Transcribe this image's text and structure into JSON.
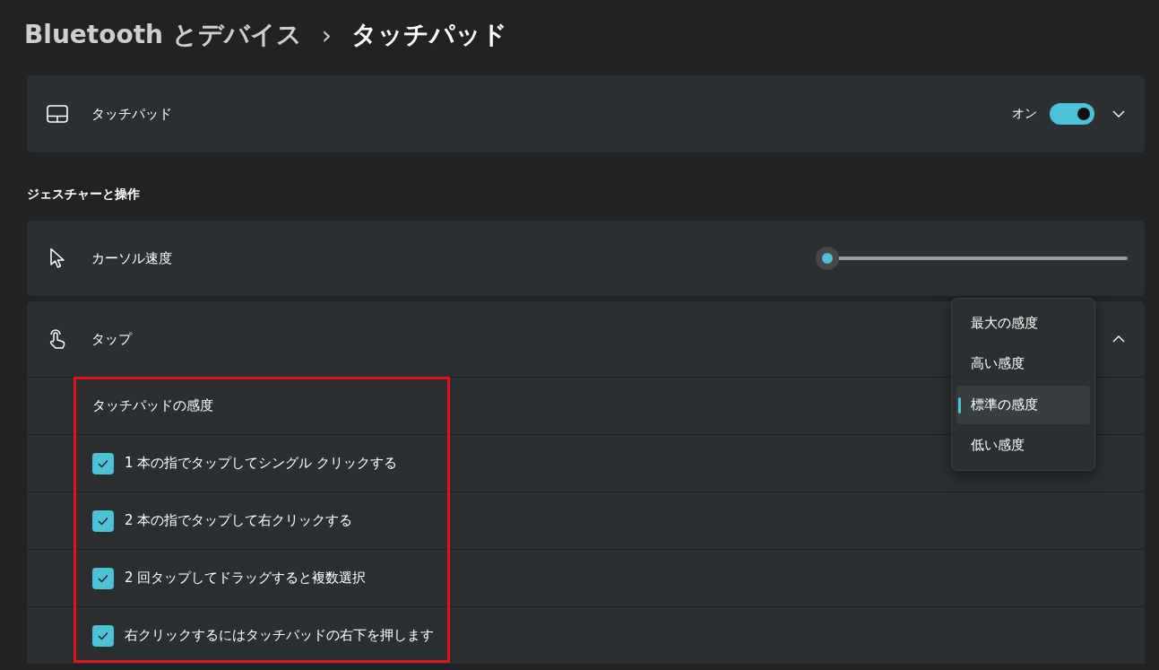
{
  "breadcrumb": {
    "parent": "Bluetooth とデバイス",
    "separator": "›",
    "current": "タッチパッド"
  },
  "touchpad": {
    "label": "タッチパッド",
    "state_label": "オン",
    "on": true,
    "expanded": false
  },
  "section_title": "ジェスチャーと操作",
  "cursor_speed": {
    "label": "カーソル速度",
    "level": 0
  },
  "tap": {
    "label": "タップ",
    "expanded": true,
    "sensitivity_label": "タッチパッドの感度",
    "options": [
      {
        "label": "1 本の指でタップしてシングル クリックする",
        "checked": true
      },
      {
        "label": "2 本の指でタップして右クリックする",
        "checked": true
      },
      {
        "label": "2 回タップしてドラッグすると複数選択",
        "checked": true
      },
      {
        "label": "右クリックするにはタッチパッドの右下を押します",
        "checked": true
      }
    ]
  },
  "sensitivity_menu": [
    {
      "label": "最大の感度",
      "selected": false
    },
    {
      "label": "高い感度",
      "selected": false
    },
    {
      "label": "標準の感度",
      "selected": true
    },
    {
      "label": "低い感度",
      "selected": false
    }
  ]
}
